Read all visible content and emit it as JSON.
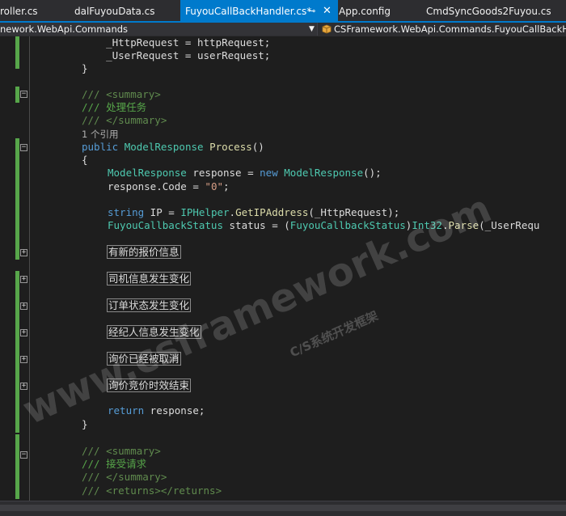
{
  "tabs": [
    {
      "label": "roller.cs",
      "active": false
    },
    {
      "label": "dalFuyouData.cs",
      "active": false
    },
    {
      "label": "FuyouCallBackHandler.cs*",
      "active": true
    },
    {
      "label": "App.config",
      "active": false
    },
    {
      "label": "CmdSyncGoods2Fuyou.cs",
      "active": false
    }
  ],
  "tab_pin_icon": "⊸",
  "tab_close_icon": "✕",
  "nav": {
    "project": "nework.WebApi.Commands",
    "member": "CSFramework.WebApi.Commands.FuyouCallBackHandler"
  },
  "code_lines": [
    "    _HttpRequest = httpRequest;",
    "    _UserRequest = userRequest;",
    "}",
    "/// <summary>",
    "/// 处理任务",
    "/// </summary>",
    "1 个引用",
    "public ModelResponse Process()",
    "{",
    "ModelResponse response = new ModelResponse();",
    "response.Code = \"0\";",
    "string IP = IPHelper.GetIPAddress(_HttpRequest);",
    "FuyouCallbackStatus status = (FuyouCallbackStatus)Int32.Parse(_UserRequ",
    "return response;",
    "}",
    "/// <summary>",
    "/// 接受请求",
    "/// </summary>",
    "/// <returns></returns>"
  ],
  "regions": [
    "有新的报价信息",
    "司机信息发生变化",
    "订单状态发生变化",
    "经纪人信息发生变化",
    "询价已经被取消",
    "询价竞价时效结束"
  ],
  "watermark": {
    "main": "www.csframework.com",
    "sub": "C/S系统开发框架"
  },
  "colors": {
    "accent": "#007acc",
    "keyword": "#569cd6",
    "type": "#4ec9b0",
    "method": "#dcdcaa",
    "string": "#d69d85",
    "comment": "#57a64a",
    "xmldoc": "#608b4e",
    "text": "#dcdcdc",
    "background": "#1e1e1e"
  }
}
